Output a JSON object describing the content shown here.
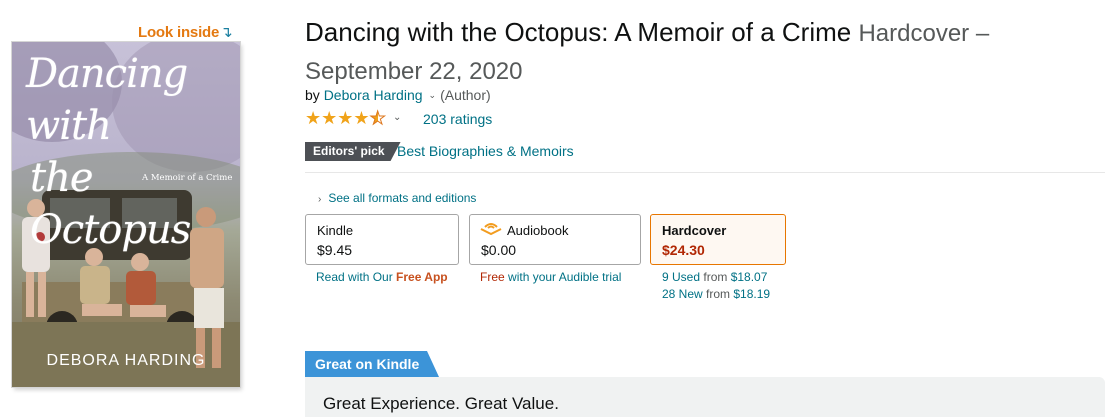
{
  "look_inside": {
    "label": "Look inside",
    "arrow": "↴"
  },
  "cover": {
    "title_line1": "Dancing with",
    "title_line2": "the Octopus",
    "subtitle": "A Memoir of a Crime",
    "author": "DEBORA HARDING"
  },
  "product": {
    "title": "Dancing with the Octopus: A Memoir of a Crime",
    "format_label": "Hardcover – September 22, 2020",
    "by_label": "by",
    "author": "Debora Harding",
    "author_role": "(Author)",
    "rating_value": 4.5,
    "ratings_count": "203 ratings",
    "editors_pick": "Editors' pick",
    "editors_pick_category": "Best Biographies & Memoirs"
  },
  "formats": {
    "see_all": "See all formats and editions",
    "options": [
      {
        "name": "Kindle",
        "price": "$9.45",
        "sub_prefix": "Read with Our ",
        "sub_bold": "Free App"
      },
      {
        "name": "Audiobook",
        "price": "$0.00",
        "sub_red": "Free",
        "sub_rest": " with your Audible trial"
      },
      {
        "name": "Hardcover",
        "price": "$24.30",
        "selected": true,
        "used_link": "9 Used",
        "used_from": " from ",
        "used_price": "$18.07",
        "new_link": "28 New",
        "new_from": " from ",
        "new_price": "$18.19"
      }
    ]
  },
  "kindle_promo": {
    "tab_label": "Great on Kindle",
    "panel_text": "Great Experience. Great Value."
  },
  "colors": {
    "link": "#007185",
    "price_red": "#b12704",
    "star": "#f0a31a",
    "look_inside": "#e47911",
    "kindle_tab": "#3c94d8",
    "selected_border": "#e77600"
  }
}
